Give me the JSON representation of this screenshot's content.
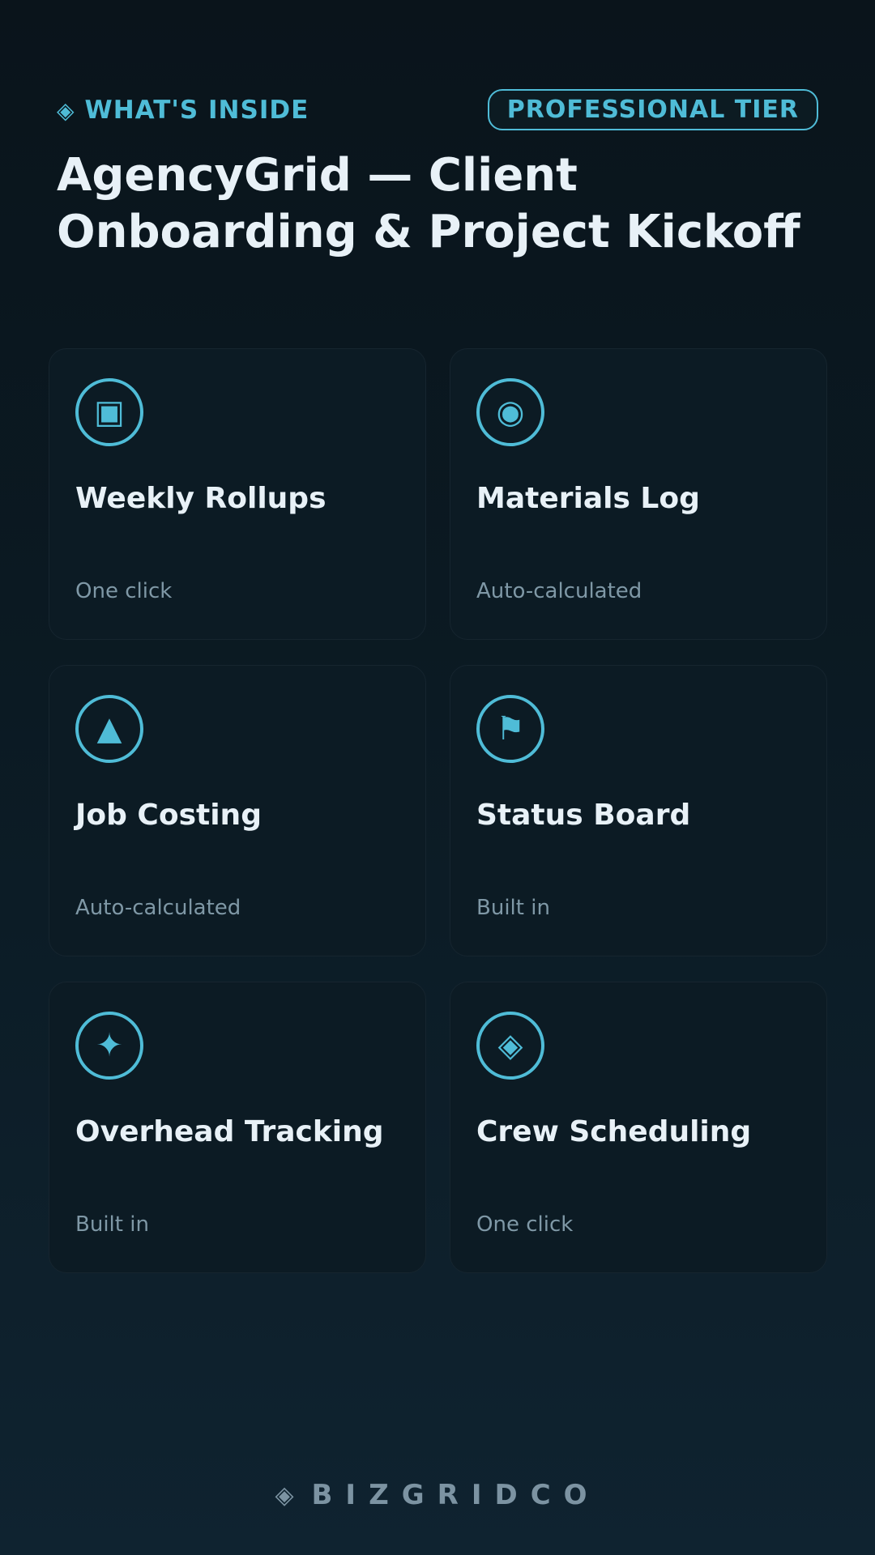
{
  "header": {
    "eyebrow_icon": "◈",
    "eyebrow_label": "WHAT'S INSIDE",
    "tier_badge": "PROFESSIONAL TIER",
    "title": "AgencyGrid — Client Onboarding & Project Kickoff"
  },
  "features": [
    {
      "icon": "▣",
      "icon_name": "square-frame-icon",
      "title": "Weekly Rollups",
      "subtitle": "One click"
    },
    {
      "icon": "◉",
      "icon_name": "target-circle-icon",
      "title": "Materials Log",
      "subtitle": "Auto-calculated"
    },
    {
      "icon": "▲",
      "icon_name": "triangle-icon",
      "title": "Job Costing",
      "subtitle": "Auto-calculated"
    },
    {
      "icon": "⚑",
      "icon_name": "flag-icon",
      "title": "Status Board",
      "subtitle": "Built in"
    },
    {
      "icon": "✦",
      "icon_name": "sparkle-star-icon",
      "title": "Overhead Tracking",
      "subtitle": "Built in"
    },
    {
      "icon": "◈",
      "icon_name": "diamond-icon",
      "title": "Crew Scheduling",
      "subtitle": "One click"
    }
  ],
  "footer": {
    "icon": "◈",
    "brand": "BIZGRIDCO"
  },
  "colors": {
    "accent": "#4fbcd7",
    "text_primary": "#e8f1f7",
    "text_secondary": "#7f98a6",
    "card_background": "#0c1b24"
  }
}
